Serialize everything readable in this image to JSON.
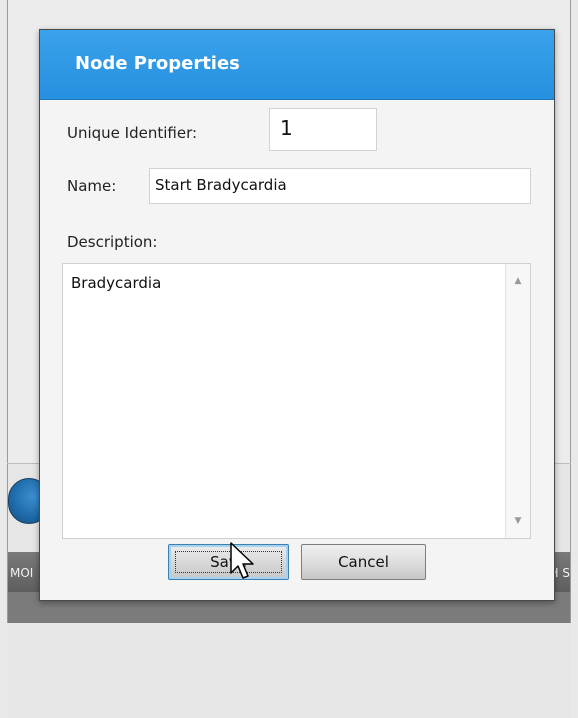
{
  "background": {
    "status_left": "MOI",
    "status_right": "H S"
  },
  "dialog": {
    "title": "Node Properties",
    "unique_identifier_label": "Unique Identifier:",
    "unique_identifier_value": "1",
    "name_label": "Name:",
    "name_value": "Start Bradycardia",
    "description_label": "Description:",
    "description_value": "Bradycardia",
    "save_label": "Save",
    "cancel_label": "Cancel"
  },
  "icons": {
    "scroll_up": "scroll-up-arrow-icon",
    "scroll_down": "scroll-down-arrow-icon",
    "cursor": "mouse-pointer-icon"
  },
  "colors": {
    "header": "#2E97E6",
    "save_focus_border": "#3C7FB1"
  }
}
